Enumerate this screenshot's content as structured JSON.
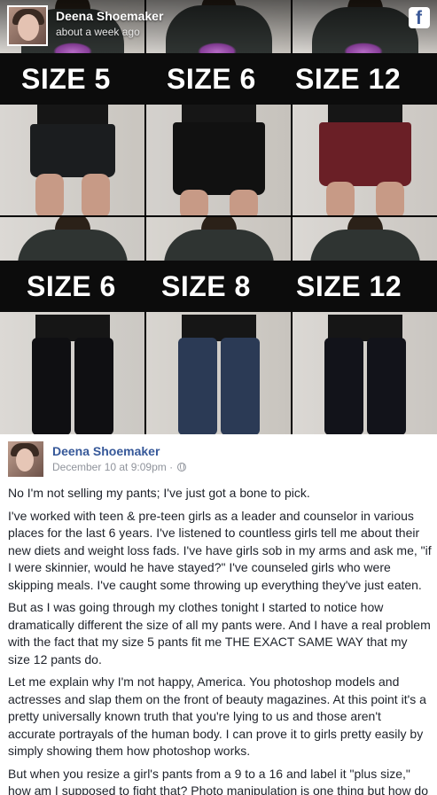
{
  "overlay": {
    "author": "Deena Shoemaker",
    "timestamp": "about a week ago",
    "brand_icon": "facebook-icon",
    "brand_color": "#3b5998"
  },
  "photos": {
    "top_row": [
      "SIZE 5",
      "SIZE 6",
      "SIZE 12"
    ],
    "bottom_row": [
      "SIZE 6",
      "SIZE 8",
      "SIZE 12"
    ]
  },
  "post": {
    "author": "Deena Shoemaker",
    "date": "December 10 at 9:09pm",
    "separator": "·",
    "privacy_icon": "globe-icon",
    "name_color": "#365899",
    "paragraphs": [
      "No I'm not selling my pants; I've just got a bone to pick.",
      "I've worked with teen & pre-teen girls as a leader and counselor in various places for the last 6 years. I've listened to countless girls tell me about their new diets and weight loss fads. I've have girls sob in my arms and ask me, \"if I were skinnier, would he have stayed?\" I've counseled girls who were skipping meals. I've caught some throwing up everything they've just eaten.",
      "But as I was going through my clothes tonight I started to notice how dramatically different the size of all my pants were. And I have a real problem with the fact that my size 5 pants fit me THE EXACT SAME WAY that my size 12 pants do.",
      "Let me explain why I'm not happy, America. You photoshop models and actresses and slap them on the front of beauty magazines. At this point it's a pretty universally known truth that you're lying to us and those aren't accurate portrayals of the human body. I can prove it to girls pretty easily by simply showing them how photoshop works.",
      "But when you resize a girl's pants from a 9 to a 16 and label it \"plus size,\" how am I supposed to fight that? Photo manipulation is one thing but how do"
    ]
  }
}
